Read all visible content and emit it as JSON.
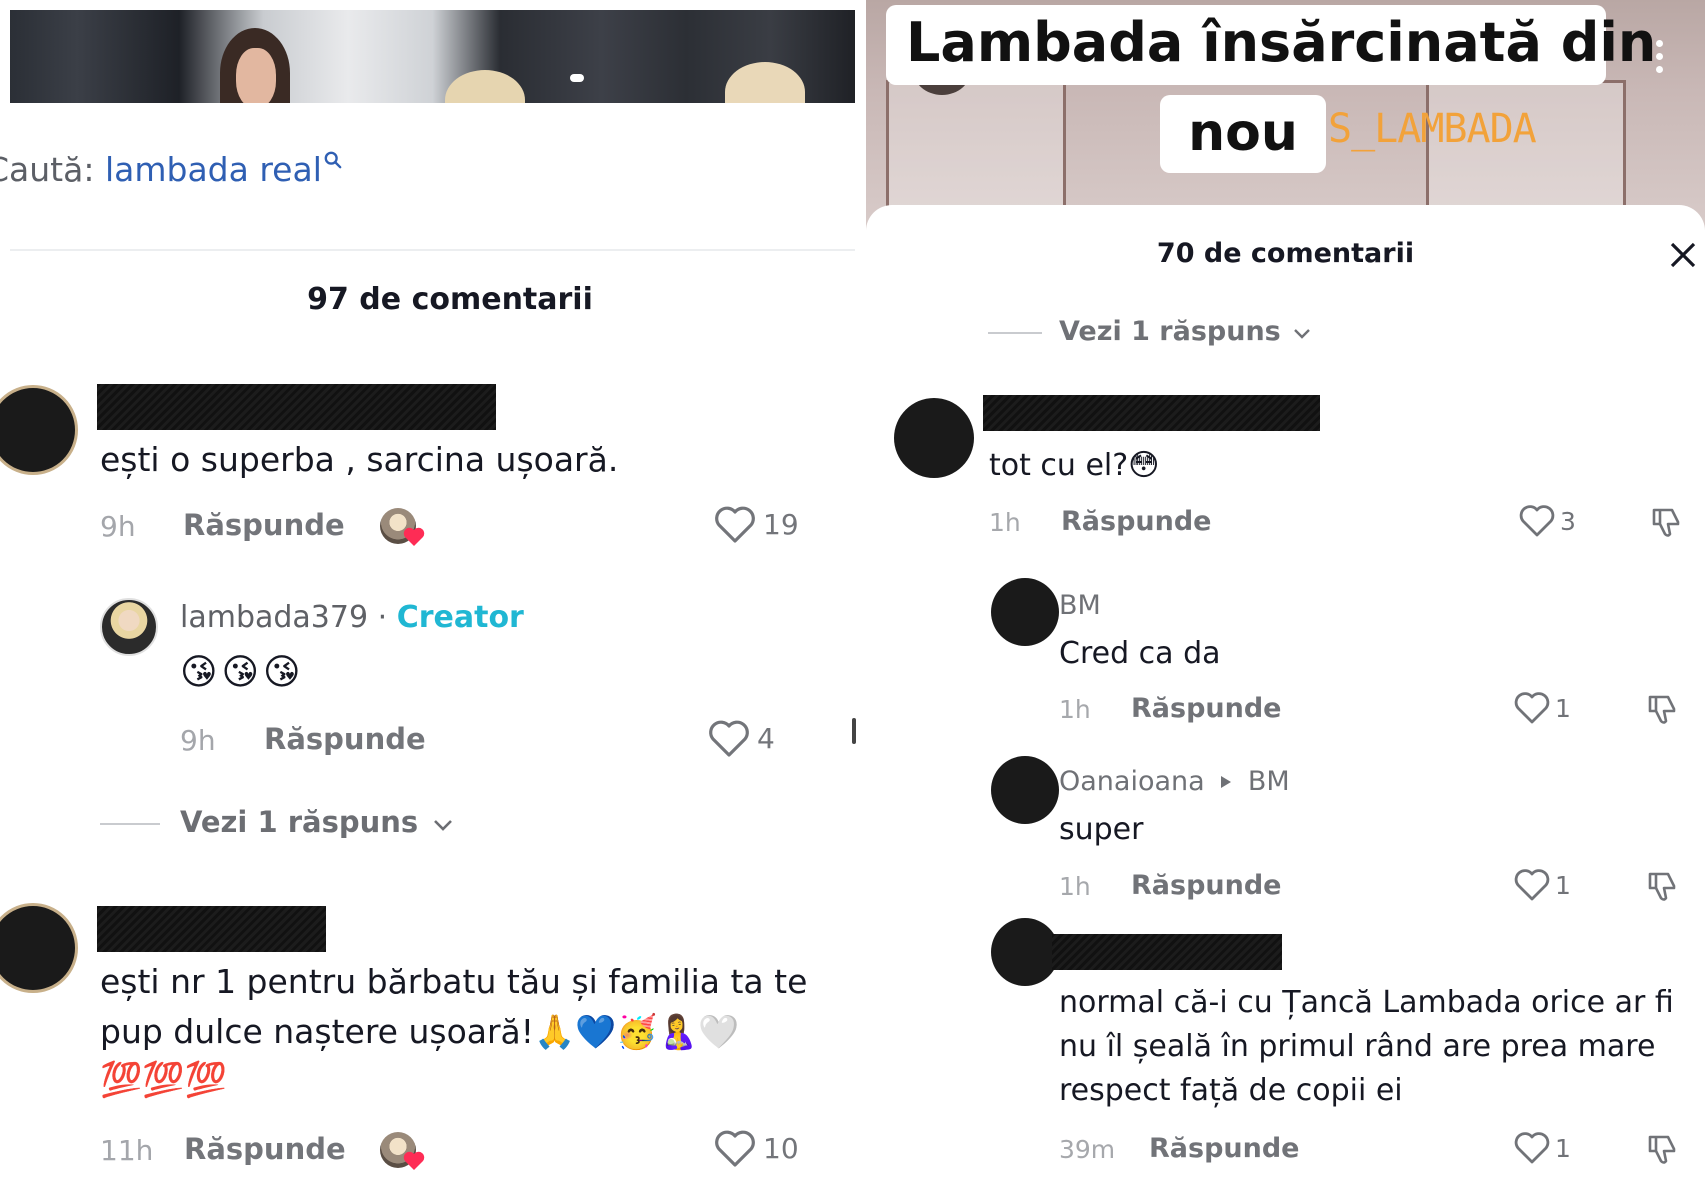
{
  "left": {
    "search": {
      "label": "Caută:",
      "term": "lambada real"
    },
    "comments_count": "97 de comentarii",
    "comments": [
      {
        "text": "ești o superba , sarcina ușoară.",
        "time": "9h",
        "reply_label": "Răspunde",
        "likes": "19"
      },
      {
        "username": "lambada379",
        "separator": "·",
        "creator_label": "Creator",
        "text": "😘😘😘",
        "time": "9h",
        "reply_label": "Răspunde",
        "likes": "4",
        "view_replies": "Vezi 1 răspuns"
      },
      {
        "line1": "ești nr 1 pentru bărbatu tău și familia ta te",
        "line2": "pup dulce naștere ușoară!🙏💙🥳🤱🤍",
        "line3": "💯💯💯",
        "time": "11h",
        "reply_label": "Răspunde",
        "likes": "10"
      }
    ]
  },
  "right": {
    "video": {
      "headline_line1": "Lambada însărcinată din",
      "headline_line2": "nou",
      "watermark": "S_LAMBADA"
    },
    "comments_count": "70 de comentarii",
    "view_replies": "Vezi 1 răspuns",
    "comments": [
      {
        "text": "tot cu el?😳",
        "time": "1h",
        "reply_label": "Răspunde",
        "likes": "3"
      },
      {
        "username": "BM",
        "text": "Cred ca da",
        "time": "1h",
        "reply_label": "Răspunde",
        "likes": "1"
      },
      {
        "username": "Oanaioana",
        "reply_to": "BM",
        "text": "super",
        "time": "1h",
        "reply_label": "Răspunde",
        "likes": "1"
      },
      {
        "line1": "normal că-i cu Țancă Lambada orice ar fi",
        "line2": "nu îl șeală în primul rând are prea mare",
        "line3": "respect față de copii ei",
        "time": "39m",
        "reply_label": "Răspunde",
        "likes": "1"
      }
    ]
  },
  "icons": {
    "heart": "heart-outline-icon",
    "dislike": "thumbs-down-icon",
    "close": "close-icon",
    "search": "magnifier-icon",
    "more": "more-vertical-icon",
    "chevron": "chevron-down-icon"
  },
  "colors": {
    "creator": "#20b7d3",
    "search_term": "#2f5fb3",
    "watermark": "#f2a23a"
  }
}
